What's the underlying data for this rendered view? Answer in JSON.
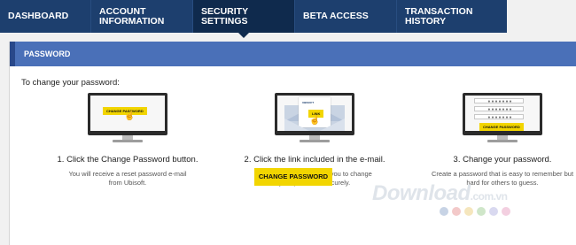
{
  "nav": {
    "tabs": [
      {
        "label": "DASHBOARD",
        "active": false
      },
      {
        "label": "ACCOUNT\nINFORMATION",
        "active": false
      },
      {
        "label": "SECURITY SETTINGS",
        "active": true
      },
      {
        "label": "BETA ACCESS",
        "active": false
      },
      {
        "label": "TRANSACTION\nHISTORY",
        "active": false
      }
    ]
  },
  "panel": {
    "title": "PASSWORD",
    "intro": "To change your password:",
    "steps": [
      {
        "title": "1. Click the Change Password button.",
        "desc": "You will receive a reset password e-mail from Ubisoft.",
        "screen_button": "CHANGE PASSWORD"
      },
      {
        "title": "2. Click the link included in the e-mail.",
        "desc": "This unique link enables you to change your password securely.",
        "screen_logo": "UBISOFT",
        "screen_button": "LINK"
      },
      {
        "title": "3. Change your password.",
        "desc": "Create a password that is easy to remember but hard for others to guess.",
        "screen_fields": [
          "●●●●●●●",
          "●●●●●●●",
          "●●●●●●●"
        ],
        "screen_button": "CHANGE PASSWORD"
      }
    ],
    "button_label": "CHANGE PASSWORD"
  },
  "watermark": {
    "text": "Download",
    "suffix": ".com.vn",
    "dot_colors": [
      "#c7d3e5",
      "#f3c9c9",
      "#f5e6bd",
      "#cfe6c9",
      "#d9d9f0",
      "#f3cfe0"
    ]
  },
  "colors": {
    "nav_bg": "#1d3f6e",
    "nav_active": "#0f2a4d",
    "panel_header": "#4a70b8",
    "accent_yellow": "#f2d500"
  }
}
